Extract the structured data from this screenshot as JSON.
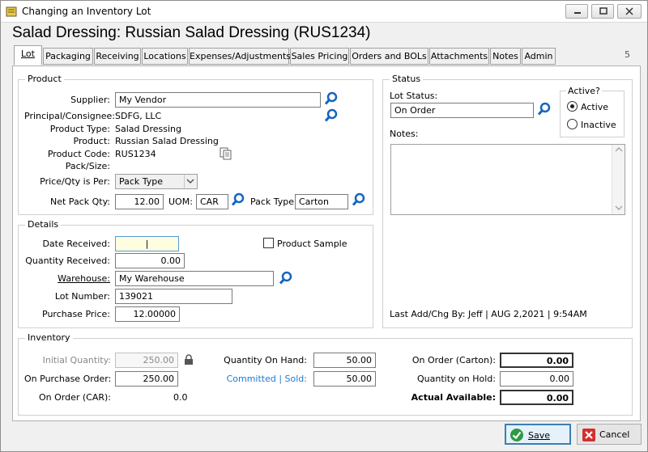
{
  "window": {
    "title": "Changing an Inventory Lot",
    "heading": "Salad Dressing: Russian Salad Dressing (RUS1234)"
  },
  "tabs": [
    {
      "label": "Lot"
    },
    {
      "label": "Packaging"
    },
    {
      "label": "Receiving"
    },
    {
      "label": "Locations"
    },
    {
      "label": "Expenses/Adjustments"
    },
    {
      "label": "Sales Pricing"
    },
    {
      "label": "Orders and BOLs"
    },
    {
      "label": "Attachments"
    },
    {
      "label": "Notes"
    },
    {
      "label": "Admin"
    }
  ],
  "tab_count": "5",
  "product": {
    "group_title": "Product",
    "supplier_label": "Supplier:",
    "supplier_value": "My Vendor",
    "principal_label": "Principal/Consignee:",
    "principal_value": "SDFG, LLC",
    "product_type_label": "Product Type:",
    "product_type_value": "Salad Dressing",
    "product_label": "Product:",
    "product_value": "Russian Salad Dressing",
    "product_code_label": "Product Code:",
    "product_code_value": "RUS1234",
    "pack_size_label": "Pack/Size:",
    "price_qty_label": "Price/Qty is Per:",
    "price_qty_value": "Pack Type",
    "net_pack_qty_label": "Net Pack Qty:",
    "net_pack_qty_value": "12.00",
    "uom_label": "UOM:",
    "uom_value": "CAR",
    "pack_type_label": "Pack Type:",
    "pack_type_value": "Carton"
  },
  "details": {
    "group_title": "Details",
    "date_received_label": "Date Received:",
    "date_received_value": "|",
    "product_sample_label": "Product Sample",
    "quantity_received_label": "Quantity Received:",
    "quantity_received_value": "0.00",
    "warehouse_label": "Warehouse:",
    "warehouse_value": "My Warehouse",
    "lot_number_label": "Lot Number:",
    "lot_number_value": "139021",
    "purchase_price_label": "Purchase Price:",
    "purchase_price_value": "12.00000"
  },
  "status": {
    "group_title": "Status",
    "lot_status_label": "Lot Status:",
    "lot_status_value": "On Order",
    "active_title": "Active?",
    "active_label": "Active",
    "inactive_label": "Inactive",
    "notes_label": "Notes:",
    "last_change": "Last Add/Chg By:  Jeff | AUG  2,2021  |  9:54AM"
  },
  "inventory": {
    "group_title": "Inventory",
    "initial_qty_label": "Initial Quantity:",
    "initial_qty_value": "250.00",
    "on_po_label": "On Purchase Order:",
    "on_po_value": "250.00",
    "on_order_car_label": "On Order (CAR):",
    "on_order_car_value": "0.0",
    "qty_on_hand_label": "Quantity On Hand:",
    "qty_on_hand_value": "50.00",
    "committed_label": "Committed | Sold:",
    "committed_value": "50.00",
    "on_order_carton_label": "On Order (Carton):",
    "on_order_carton_value": "0.00",
    "qty_on_hold_label": "Quantity on Hold:",
    "qty_on_hold_value": "0.00",
    "actual_available_label": "Actual Available:",
    "actual_available_value": "0.00"
  },
  "buttons": {
    "save": "Save",
    "cancel": "Cancel"
  },
  "colors": {
    "accent": "#1f7ad6",
    "save_icon": "#2e9b43",
    "cancel_icon": "#d32f2f",
    "lookup_icon": "#1565c0"
  }
}
